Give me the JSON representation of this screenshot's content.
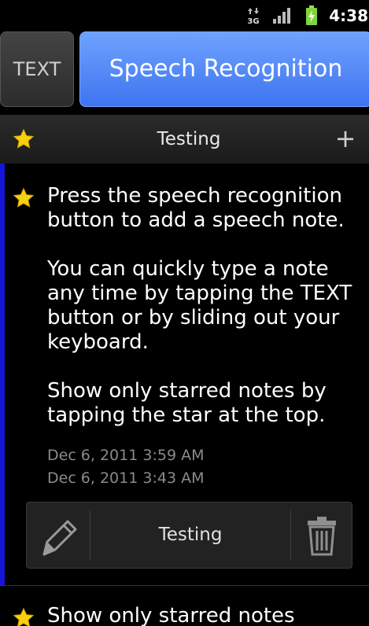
{
  "status_bar": {
    "network": "3G",
    "network_icon": "3g-data-icon",
    "signal_icon": "signal-strength-icon",
    "battery_icon": "battery-charging-icon",
    "time": "4:38"
  },
  "top_buttons": {
    "text_label": "TEXT",
    "speech_label": "Speech Recognition",
    "speech_color": "#4a80f5"
  },
  "notebook_bar": {
    "star_icon": "star-icon",
    "title": "Testing",
    "add_label": "+"
  },
  "notes": [
    {
      "starred": true,
      "paragraphs": [
        "Press the speech recognition button to add a speech note.",
        "You can quickly type a note any time by tapping the TEXT button or by sliding out your keyboard.",
        "Show only starred notes by tapping the star at the top."
      ],
      "dates": [
        "Dec 6, 2011 3:59 AM",
        "Dec 6, 2011 3:43 AM"
      ],
      "toolbar": {
        "edit_icon": "pencil-icon",
        "notebook_label": "Testing",
        "delete_icon": "trash-icon"
      },
      "accent_color": "#1515d8"
    },
    {
      "starred": true,
      "text": "Show only starred notes"
    }
  ]
}
